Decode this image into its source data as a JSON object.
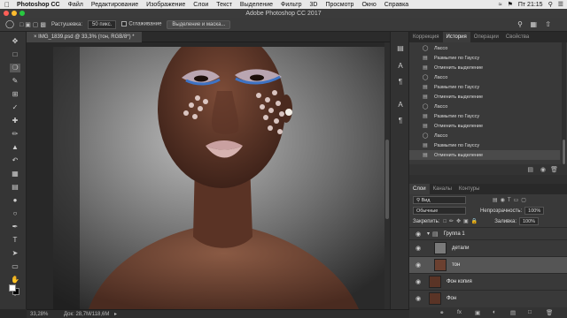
{
  "menubar": {
    "app": "Photoshop CC",
    "items": [
      "Файл",
      "Редактирование",
      "Изображение",
      "Слои",
      "Текст",
      "Выделение",
      "Фильтр",
      "3D",
      "Просмотр",
      "Окно",
      "Справка"
    ],
    "clock": "Пт 21:15"
  },
  "window": {
    "title": "Adobe Photoshop CC 2017"
  },
  "options": {
    "feather_label": "Растушевка:",
    "feather_value": "50 пикс.",
    "antialias_label": "Сглаживание",
    "select_mask_label": "Выделение и маска..."
  },
  "document": {
    "tab_label": "IMG_1839.psd @ 33,3% (тон, RGB/8*) *",
    "zoom": "33,28%",
    "doc_size": "Док: 28,7M/118,6M"
  },
  "history_panel": {
    "tabs": [
      "Коррекция",
      "История",
      "Операции",
      "Свойства"
    ],
    "active_tab": "История",
    "items": [
      {
        "icon": "lasso-icon",
        "label": "Лассо"
      },
      {
        "icon": "history-step-icon",
        "label": "Размытие по Гауссу"
      },
      {
        "icon": "history-step-icon",
        "label": "Отменить выделение"
      },
      {
        "icon": "lasso-icon",
        "label": "Лассо"
      },
      {
        "icon": "history-step-icon",
        "label": "Размытие по Гауссу"
      },
      {
        "icon": "history-step-icon",
        "label": "Отменить выделение"
      },
      {
        "icon": "lasso-icon",
        "label": "Лассо"
      },
      {
        "icon": "history-step-icon",
        "label": "Размытие по Гауссу"
      },
      {
        "icon": "history-step-icon",
        "label": "Отменить выделение"
      },
      {
        "icon": "lasso-icon",
        "label": "Лассо"
      },
      {
        "icon": "history-step-icon",
        "label": "Размытие по Гауссу"
      },
      {
        "icon": "history-step-icon",
        "label": "Отменить выделение"
      }
    ],
    "selected_index": 11
  },
  "layers_panel": {
    "tabs": [
      "Слои",
      "Каналы",
      "Контуры"
    ],
    "active_tab": "Слои",
    "filter_label": "Вид",
    "blend_mode": "Обычные",
    "opacity_label": "Непрозрачность:",
    "opacity_value": "100%",
    "lock_label": "Закрепить:",
    "fill_label": "Заливка:",
    "fill_value": "100%",
    "group_name": "Группа 1",
    "layers": [
      {
        "name": "детали",
        "selected": false,
        "thumb": "#7a7a7a"
      },
      {
        "name": "тон",
        "selected": true,
        "thumb": "#6b4030"
      },
      {
        "name": "Фон копия",
        "selected": false,
        "thumb": "#5a3426"
      },
      {
        "name": "Фон",
        "selected": false,
        "thumb": "#5a3426"
      }
    ]
  },
  "tools": [
    "move-tool-icon",
    "marquee-tool-icon",
    "lasso-tool-icon",
    "quick-select-tool-icon",
    "crop-tool-icon",
    "eyedropper-tool-icon",
    "healing-brush-tool-icon",
    "brush-tool-icon",
    "clone-stamp-tool-icon",
    "history-brush-tool-icon",
    "eraser-tool-icon",
    "gradient-tool-icon",
    "blur-tool-icon",
    "dodge-tool-icon",
    "pen-tool-icon",
    "type-tool-icon",
    "path-select-tool-icon",
    "shape-tool-icon",
    "hand-tool-icon",
    "zoom-tool-icon"
  ]
}
